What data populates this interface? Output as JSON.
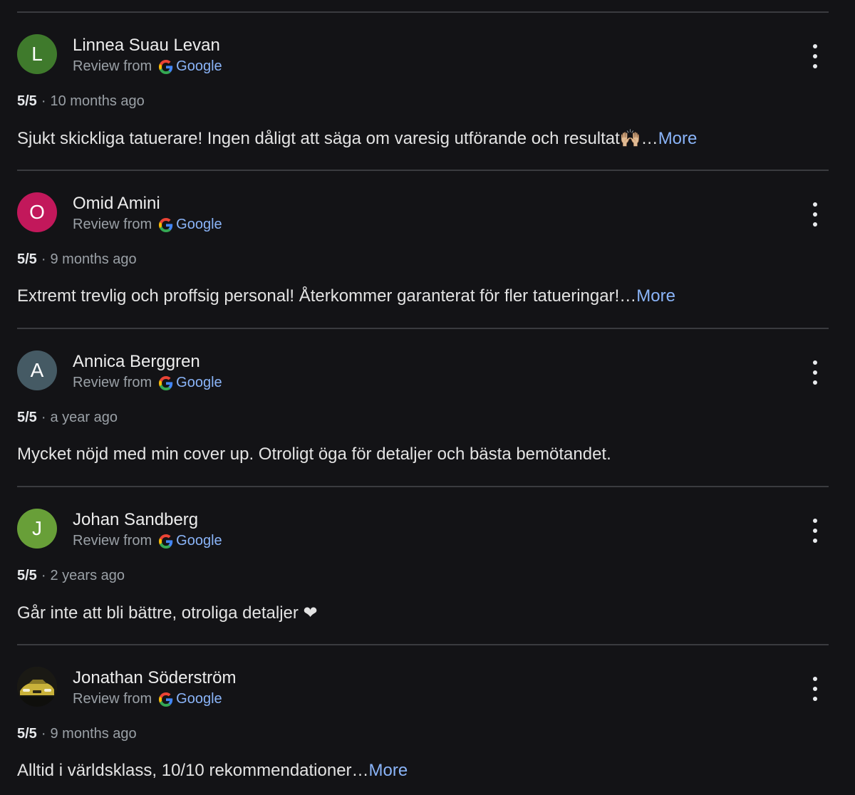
{
  "reviews": [
    {
      "initial": "L",
      "avatar_color": "#3f7a2c",
      "author": "Linnea Suau Levan",
      "review_from": "Review from",
      "source": "Google",
      "rating": "5/5",
      "separator": "·",
      "time": "10 months ago",
      "text": "Sjukt skickliga tatuerare! Ingen dåligt att säga om varesig utförande och resultat🙌🏼…",
      "more": "More"
    },
    {
      "initial": "O",
      "avatar_color": "#c2185b",
      "author": "Omid Amini",
      "review_from": "Review from",
      "source": "Google",
      "rating": "5/5",
      "separator": "·",
      "time": "9 months ago",
      "text": "Extremt trevlig och proffsig personal! Återkommer garanterat för fler tatueringar!…",
      "more": "More"
    },
    {
      "initial": "A",
      "avatar_color": "#455a64",
      "author": "Annica Berggren",
      "review_from": "Review from",
      "source": "Google",
      "rating": "5/5",
      "separator": "·",
      "time": "a year ago",
      "text": "Mycket nöjd med min cover up. Otroligt öga för detaljer och bästa bemötandet.",
      "more": ""
    },
    {
      "initial": "J",
      "avatar_color": "#689f38",
      "author": "Johan Sandberg",
      "review_from": "Review from",
      "source": "Google",
      "rating": "5/5",
      "separator": "·",
      "time": "2 years ago",
      "text": "Går inte att bli bättre, otroliga detaljer ❤",
      "more": ""
    },
    {
      "initial": "",
      "avatar_color": "#2a281f",
      "author": "Jonathan Söderström",
      "review_from": "Review from",
      "source": "Google",
      "rating": "5/5",
      "separator": "·",
      "time": "9 months ago",
      "text": "Alltid i världsklass, 10/10 rekommendationer…",
      "more": "More"
    }
  ],
  "icons": {
    "google": "google-g-icon",
    "more_options": "more-vert-icon",
    "photo_avatar": "car-photo-avatar"
  },
  "colors": {
    "background": "#131316",
    "link": "#8ab4f8",
    "muted": "#9aa0a6"
  }
}
